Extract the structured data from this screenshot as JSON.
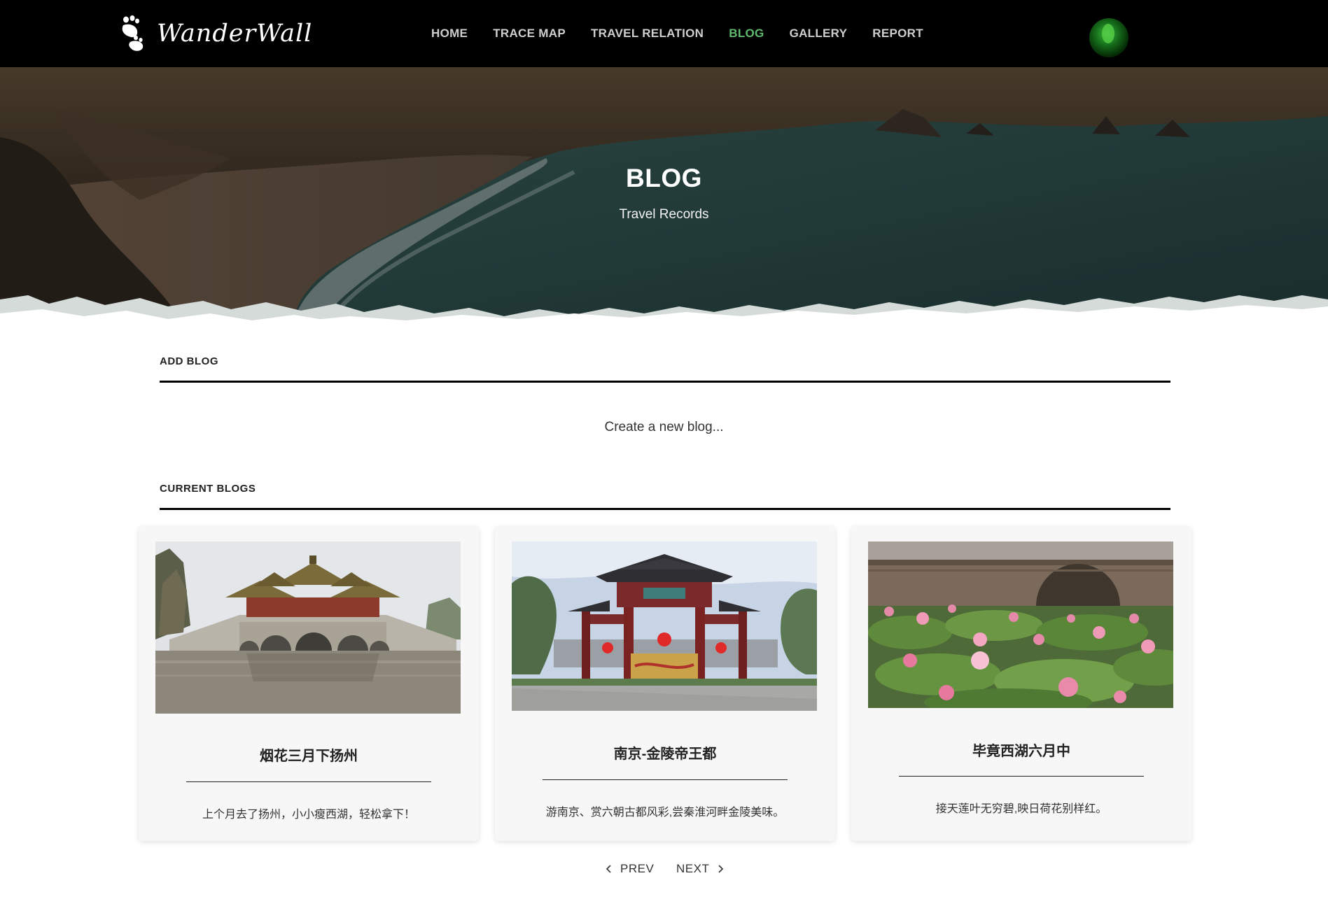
{
  "brand": {
    "name": "WanderWall",
    "logo_icon": "footprints-icon"
  },
  "nav": {
    "items": [
      {
        "label": "HOME",
        "active": false
      },
      {
        "label": "TRACE MAP",
        "active": false
      },
      {
        "label": "TRAVEL RELATION",
        "active": false
      },
      {
        "label": "BLOG",
        "active": true
      },
      {
        "label": "GALLERY",
        "active": false
      },
      {
        "label": "REPORT",
        "active": false
      }
    ],
    "active_color": "#5fba70",
    "avatar_icon": "user-avatar"
  },
  "hero": {
    "title": "BLOG",
    "subtitle": "Travel Records"
  },
  "add_blog": {
    "heading": "ADD BLOG",
    "create_link": "Create a new blog..."
  },
  "current_blogs": {
    "heading": "CURRENT BLOGS",
    "cards": [
      {
        "title": "烟花三月下扬州",
        "description": "上个月去了扬州，小小瘦西湖，轻松拿下！",
        "image": "yangzhou-five-pavilion-bridge"
      },
      {
        "title": "南京-金陵帝王都",
        "description": "游南京、赏六朝古都风彩,尝秦淮河畔金陵美味。",
        "image": "nanjing-confucius-temple-archway"
      },
      {
        "title": "毕竟西湖六月中",
        "description": "接天莲叶无穷碧,映日荷花别样红。",
        "image": "west-lake-lotus-bridge"
      }
    ]
  },
  "pagination": {
    "prev": "PREV",
    "next": "NEXT"
  }
}
